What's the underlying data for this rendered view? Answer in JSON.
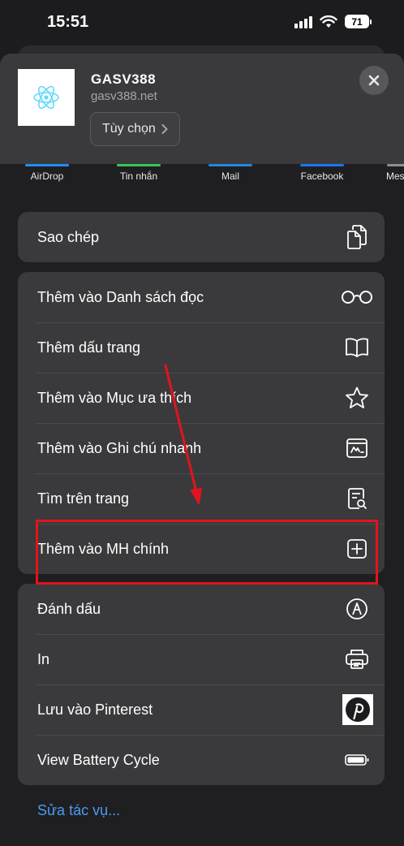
{
  "status_bar": {
    "time": "15:51",
    "battery": "71"
  },
  "header": {
    "site_name": "GASV388",
    "site_url": "gasv388.net",
    "options_label": "Tùy chọn",
    "icon": "react-atom-icon"
  },
  "share_targets": [
    {
      "label": "AirDrop",
      "color": "#1e90ff"
    },
    {
      "label": "Tin nhắn",
      "color": "#34c759"
    },
    {
      "label": "Mail",
      "color": "#1e88e5"
    },
    {
      "label": "Facebook",
      "color": "#1877f2"
    },
    {
      "label": "Mes",
      "color": "#8e8e93"
    }
  ],
  "groups": [
    {
      "items": [
        {
          "label": "Sao chép",
          "icon": "copy-icon"
        }
      ]
    },
    {
      "items": [
        {
          "label": "Thêm vào Danh sách đọc",
          "icon": "glasses-icon"
        },
        {
          "label": "Thêm dấu trang",
          "icon": "book-icon"
        },
        {
          "label": "Thêm vào Mục ưa thích",
          "icon": "star-icon"
        },
        {
          "label": "Thêm vào Ghi chú nhanh",
          "icon": "quick-note-icon"
        },
        {
          "label": "Tìm trên trang",
          "icon": "find-on-page-icon"
        },
        {
          "label": "Thêm vào MH chính",
          "icon": "add-square-icon"
        }
      ]
    },
    {
      "items": [
        {
          "label": "Đánh dấu",
          "icon": "markup-icon"
        },
        {
          "label": "In",
          "icon": "printer-icon"
        },
        {
          "label": "Lưu vào Pinterest",
          "icon": "pinterest-icon"
        },
        {
          "label": "View Battery Cycle",
          "icon": "battery-icon"
        }
      ]
    }
  ],
  "edit_actions_label": "Sửa tác vụ...",
  "annotation_color": "#e0141e"
}
